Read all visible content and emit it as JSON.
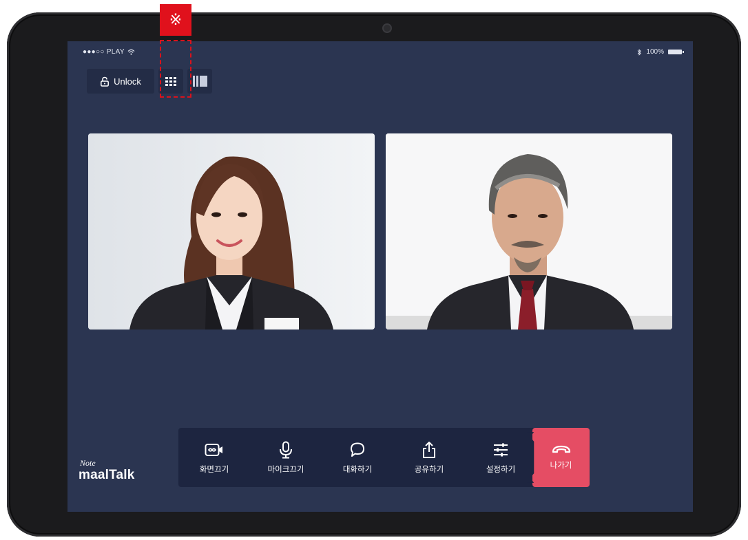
{
  "status_bar": {
    "carrier": "●●●○○ PLAY",
    "battery": "100%"
  },
  "toolbar": {
    "unlock_label": "Unlock"
  },
  "annotation": {
    "mark": "※"
  },
  "logo": {
    "line1": "Note",
    "line2": "maalTalk"
  },
  "controls": [
    {
      "label": "화면끄기",
      "icon": "video-camera-icon"
    },
    {
      "label": "마이크끄기",
      "icon": "microphone-icon"
    },
    {
      "label": "대화하기",
      "icon": "chat-bubble-icon"
    },
    {
      "label": "공유하기",
      "icon": "share-icon"
    },
    {
      "label": "설정하기",
      "icon": "settings-sliders-icon"
    }
  ],
  "leave": {
    "label": "나가기",
    "icon": "hang-up-icon"
  },
  "colors": {
    "screen_bg": "#2b3551",
    "toolbar_bg": "#1d2540",
    "leave": "#e54d64",
    "annotation": "#e0111c"
  }
}
